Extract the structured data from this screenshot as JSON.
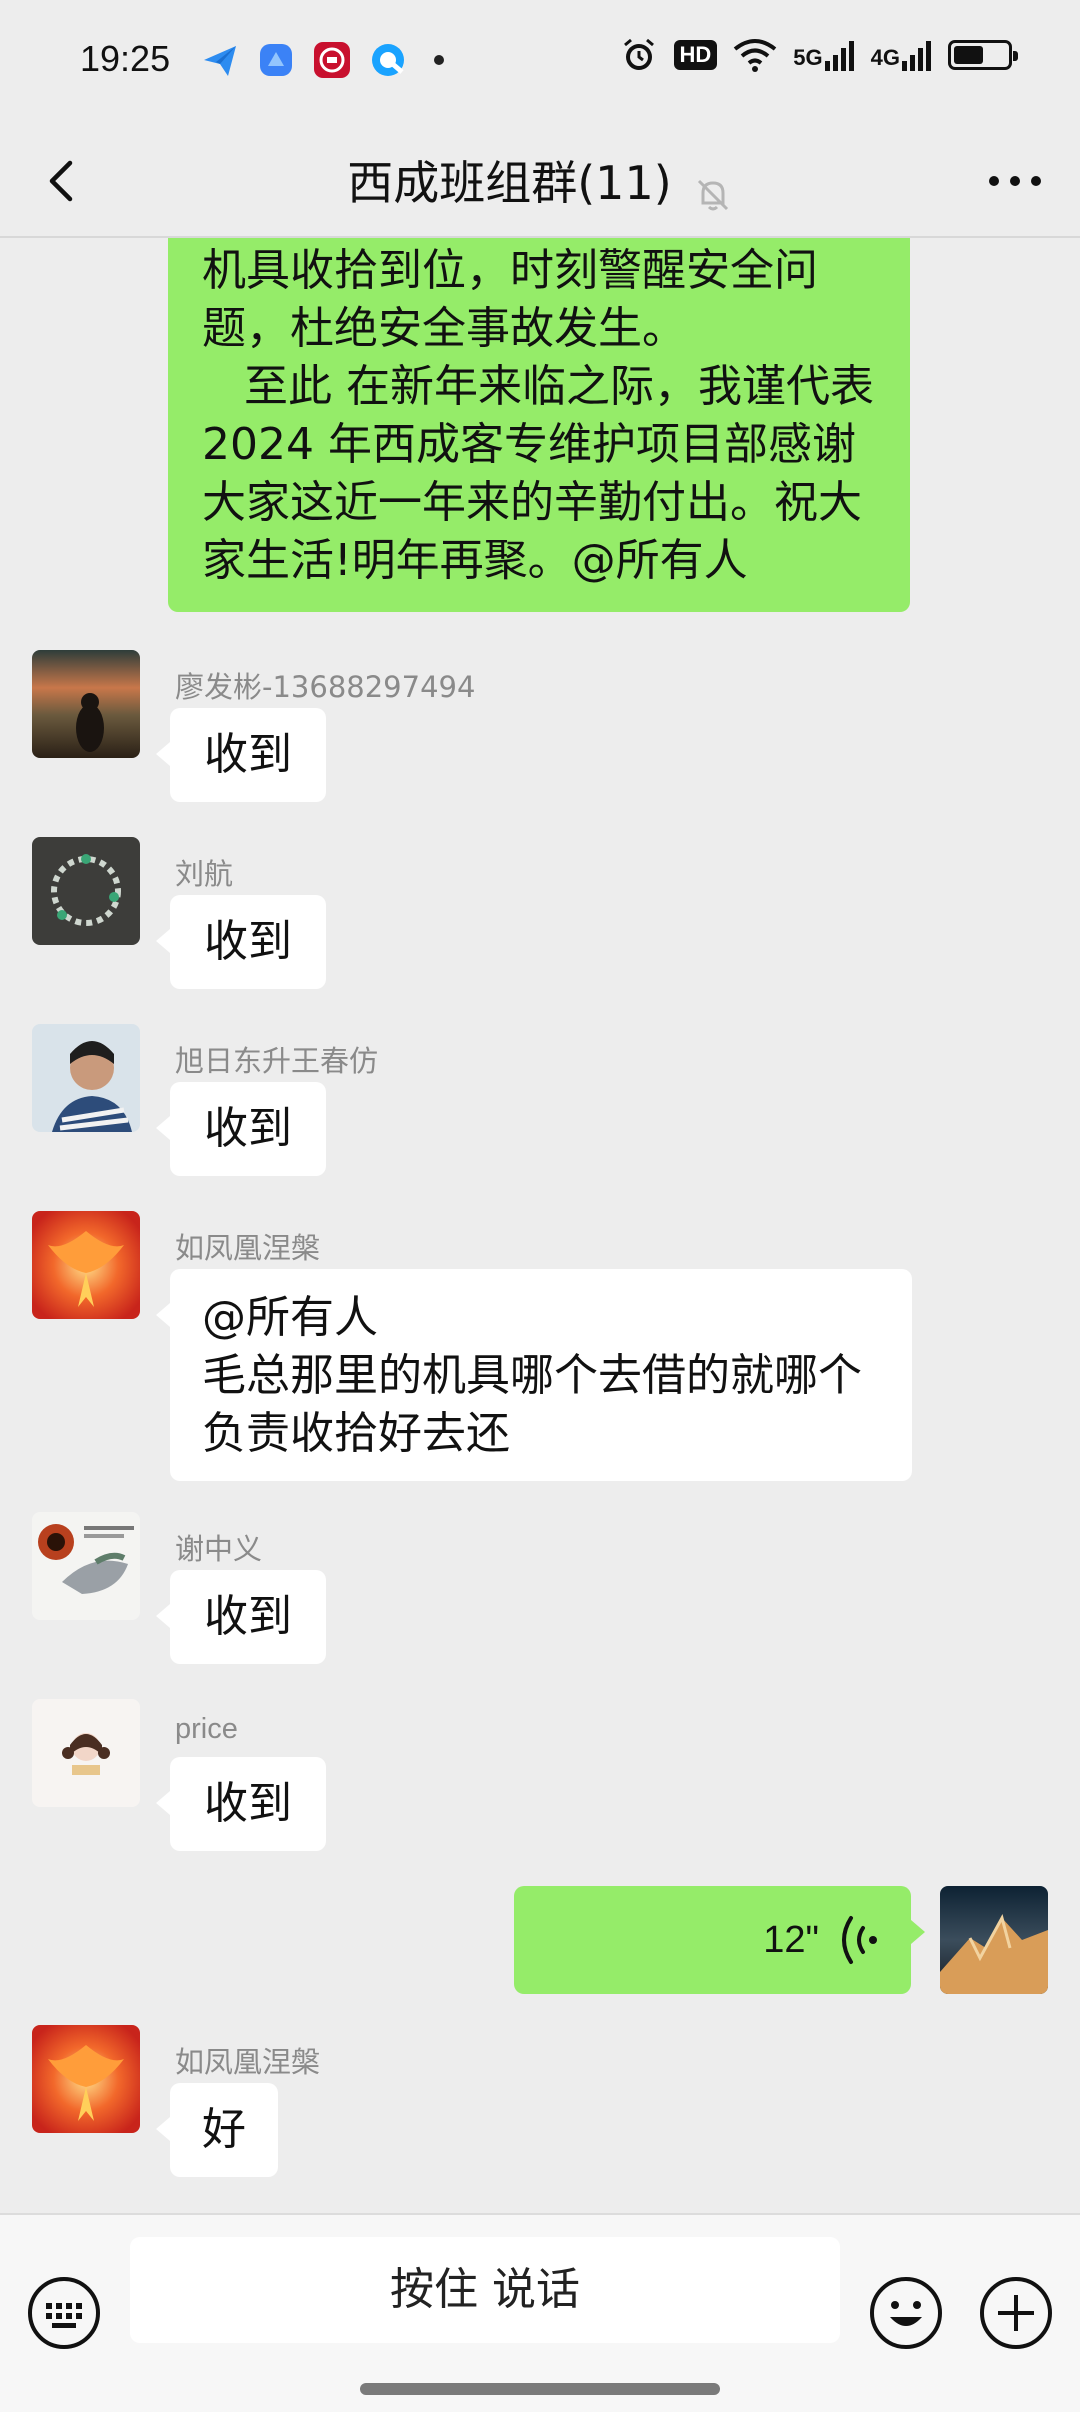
{
  "status_bar": {
    "time": "19:25",
    "hd_badge": "HD",
    "network_1": "5G",
    "network_2": "4G",
    "battery_level": 0.55
  },
  "header": {
    "title": "西成班组群(11)",
    "back_icon": "chevron-left-icon",
    "mute_icon": "bell-off-icon",
    "more_icon": "more-dots-icon"
  },
  "messages": [
    {
      "sender": "",
      "side": "right",
      "text": "机具收拾到位，时刻警醒安全问题，杜绝安全事故发生。\n   至此 在新年来临之际，我谨代表2024 年西成客专维护项目部感谢大家这近一年来的辛勤付出。祝大家生活!明年再聚。@所有人"
    },
    {
      "sender": "廖发彬-13688297494",
      "side": "left",
      "text": "收到"
    },
    {
      "sender": "刘航",
      "side": "left",
      "text": "收到"
    },
    {
      "sender": "旭日东升王春仿",
      "side": "left",
      "text": "收到"
    },
    {
      "sender": "如凤凰涅槃",
      "side": "left",
      "text": "@所有人\n毛总那里的机具哪个去借的就哪个负责收拾好去还"
    },
    {
      "sender": "谢中义",
      "side": "left",
      "text": "收到"
    },
    {
      "sender": "price",
      "side": "left",
      "text": "收到"
    },
    {
      "sender": "",
      "side": "right",
      "type": "voice",
      "duration": "12\""
    },
    {
      "sender": "如凤凰涅槃",
      "side": "left",
      "text": "好"
    }
  ],
  "bottom_bar": {
    "voice_button_label": "按住 说话",
    "keyboard_icon": "keyboard-icon",
    "emoji_icon": "emoji-icon",
    "plus_icon": "plus-circle-icon"
  },
  "colors": {
    "background": "#ededed",
    "my_bubble": "#95ec69",
    "other_bubble": "#ffffff",
    "sender_name": "#8a8a8a"
  }
}
